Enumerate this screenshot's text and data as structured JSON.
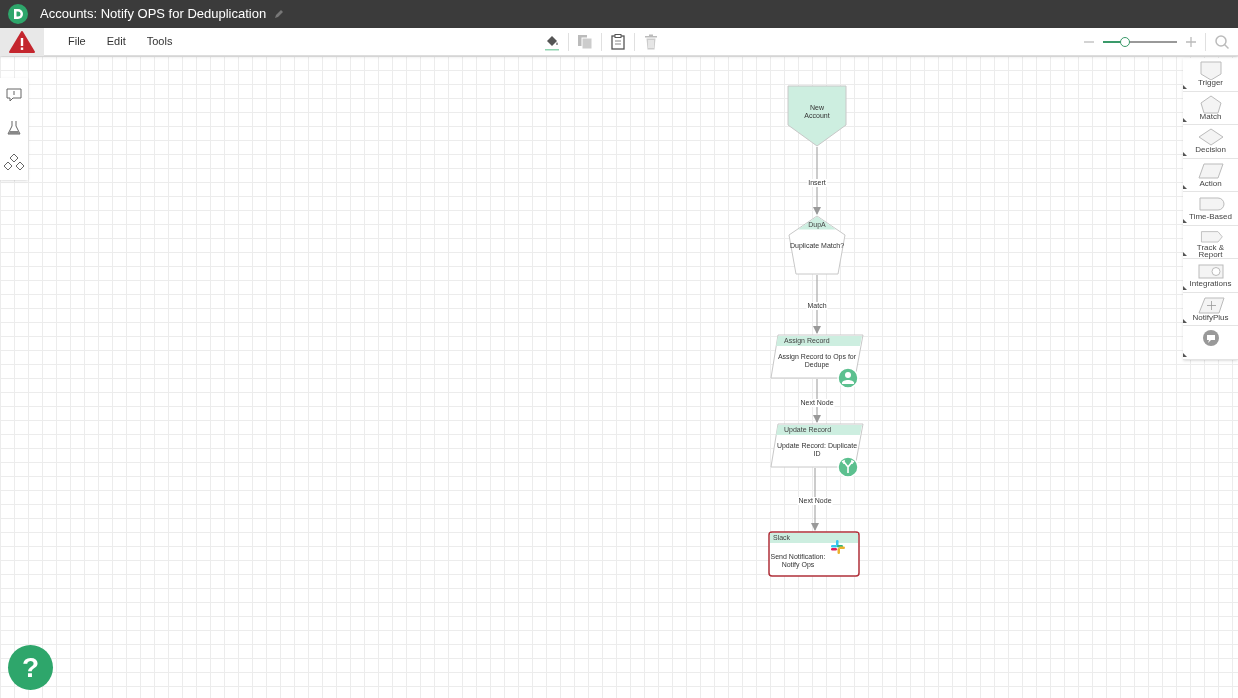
{
  "window": {
    "title": "Accounts: Notify OPS for Deduplication"
  },
  "menu": [
    "File",
    "Edit",
    "Tools"
  ],
  "zoom": {
    "level": 0.3
  },
  "nodes": [
    {
      "kind": "trigger",
      "text": "New\nAccount",
      "selected": false
    },
    {
      "kind": "match",
      "header": "DupA",
      "text": "Duplicate Match?",
      "selected": false
    },
    {
      "kind": "action",
      "header": "Assign Record",
      "text": "Assign Record to Ops for\nDedupe",
      "badge": {
        "kind": "person"
      },
      "selected": false
    },
    {
      "kind": "action",
      "header": "Update Record",
      "text": "Update Record: Duplicate\nID",
      "badge": {
        "kind": "branch"
      },
      "selected": false
    },
    {
      "kind": "notify",
      "header": "Slack",
      "text": "Send Notification:\nNotify Ops",
      "selected": true
    }
  ],
  "edges": [
    {
      "label": "Insert"
    },
    {
      "label": "Match"
    },
    {
      "label": "Next Node"
    },
    {
      "label": "Next Node"
    }
  ],
  "palette": [
    {
      "kind": "trigger",
      "label": "Trigger"
    },
    {
      "kind": "match",
      "label": "Match"
    },
    {
      "kind": "decision",
      "label": "Decision"
    },
    {
      "kind": "action",
      "label": "Action"
    },
    {
      "kind": "time",
      "label": "Time-Based"
    },
    {
      "kind": "track",
      "label": "Track &\nReport"
    },
    {
      "kind": "integrations",
      "label": "Integrations"
    },
    {
      "kind": "notifyplus",
      "label": "NotifyPlus"
    },
    {
      "kind": "comment"
    }
  ],
  "help": {
    "label": "?"
  }
}
